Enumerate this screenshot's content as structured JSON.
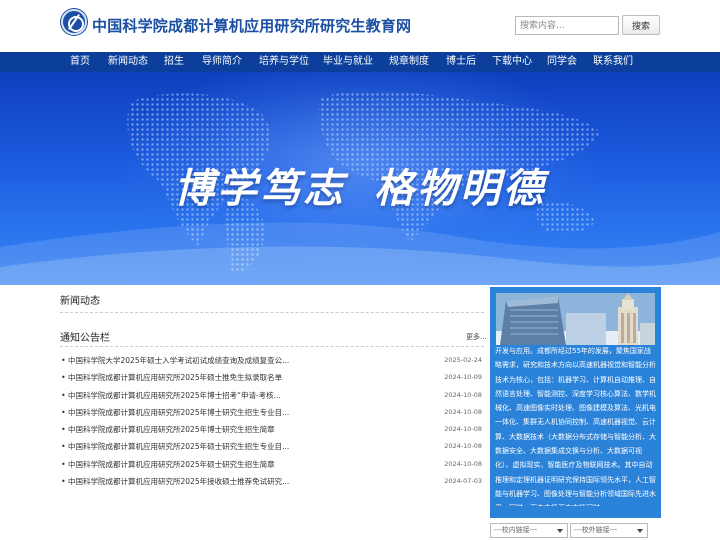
{
  "header": {
    "site_title": "中国科学院成都计算机应用研究所研究生教育网",
    "search_placeholder": "搜索内容...",
    "search_button": "搜索"
  },
  "nav": [
    "首页",
    "新闻动态",
    "招生",
    "导师简介",
    "培养与学位",
    "毕业与就业",
    "规章制度",
    "博士后",
    "下载中心",
    "同学会",
    "联系我们"
  ],
  "banner": {
    "slogan_part1": "博学笃志",
    "slogan_part2": "格物明德"
  },
  "news": {
    "heading": "新闻动态"
  },
  "notices": {
    "heading": "通知公告栏",
    "more": "更多...",
    "items": [
      {
        "title": "中国科学院大学2025年硕士入学考试初试成绩查询及成绩复查公...",
        "date": "2025-02-24"
      },
      {
        "title": "中国科学院成都计算机应用研究所2025年硕士推免生拟录取名单",
        "date": "2024-10-09"
      },
      {
        "title": "中国科学院成都计算机应用研究所2025年博士招考“申请-考核...",
        "date": "2024-10-08"
      },
      {
        "title": "中国科学院成都计算机应用研究所2025年博士研究生招生专业目...",
        "date": "2024-10-08"
      },
      {
        "title": "中国科学院成都计算机应用研究所2025年博士研究生招生简章",
        "date": "2024-10-08"
      },
      {
        "title": "中国科学院成都计算机应用研究所2025年硕士研究生招生专业目...",
        "date": "2024-10-08"
      },
      {
        "title": "中国科学院成都计算机应用研究所2025年硕士研究生招生简章",
        "date": "2024-10-08"
      },
      {
        "title": "中国科学院成都计算机应用研究所2025年接收硕士推荐免试研究...",
        "date": "2024-07-03"
      }
    ]
  },
  "intro": {
    "text": "开发与应用。成都所经过55年的发展，聚焦国家战略需求，研究和技术方向以高速机器视觉和智能分析技术为核心，包括：机器学习、计算机自动推理、自然语言处理、智能测控、深度学习核心算法、数学机械化、高速图像实时处理、图像建模及算法、光机电一体化、集群无人机协同控制、高速机器视觉、云计算、大数据技术（大数据分布式存储与智能分析、大数据安全、大数据集成交换与分析、大数据可视化）、虚拟现实、智能医疗及物联网技术。其中自动推理和定理机器证明研究保持国际领先水平，人工智能与机器学习、图像处理与智能分析领域国际先进水平。同时，面向市场面向市场同时，"
  },
  "links": {
    "campus": "---校内链接---",
    "external": "---校外链接---"
  },
  "colors": {
    "nav_bg": "#0b3f9b",
    "title_blue": "#1a4fa3",
    "panel_blue": "#2b82d9"
  }
}
